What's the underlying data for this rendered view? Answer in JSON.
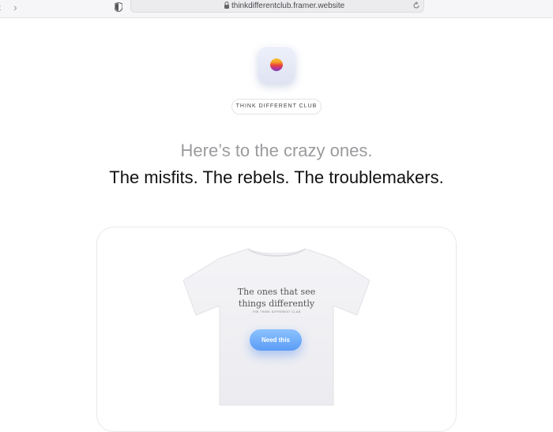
{
  "browser": {
    "back_icon": "chevron-left-icon",
    "forward_icon": "chevron-right-icon",
    "url": "thinkdifferentclub.framer.website"
  },
  "hero": {
    "badge": "THINK DIFFERENT CLUB",
    "line1": "Here’s to the crazy ones.",
    "line2": "The misfits. The rebels. The troublemakers."
  },
  "product": {
    "shirt_text": "The ones that see things differently",
    "shirt_small": "THE THINK DIFFERENT CLUB",
    "button_label": "Need this"
  },
  "colors": {
    "accent": "#5b9cf5",
    "muted_heading": "#9b9b9f",
    "heading": "#111111"
  }
}
